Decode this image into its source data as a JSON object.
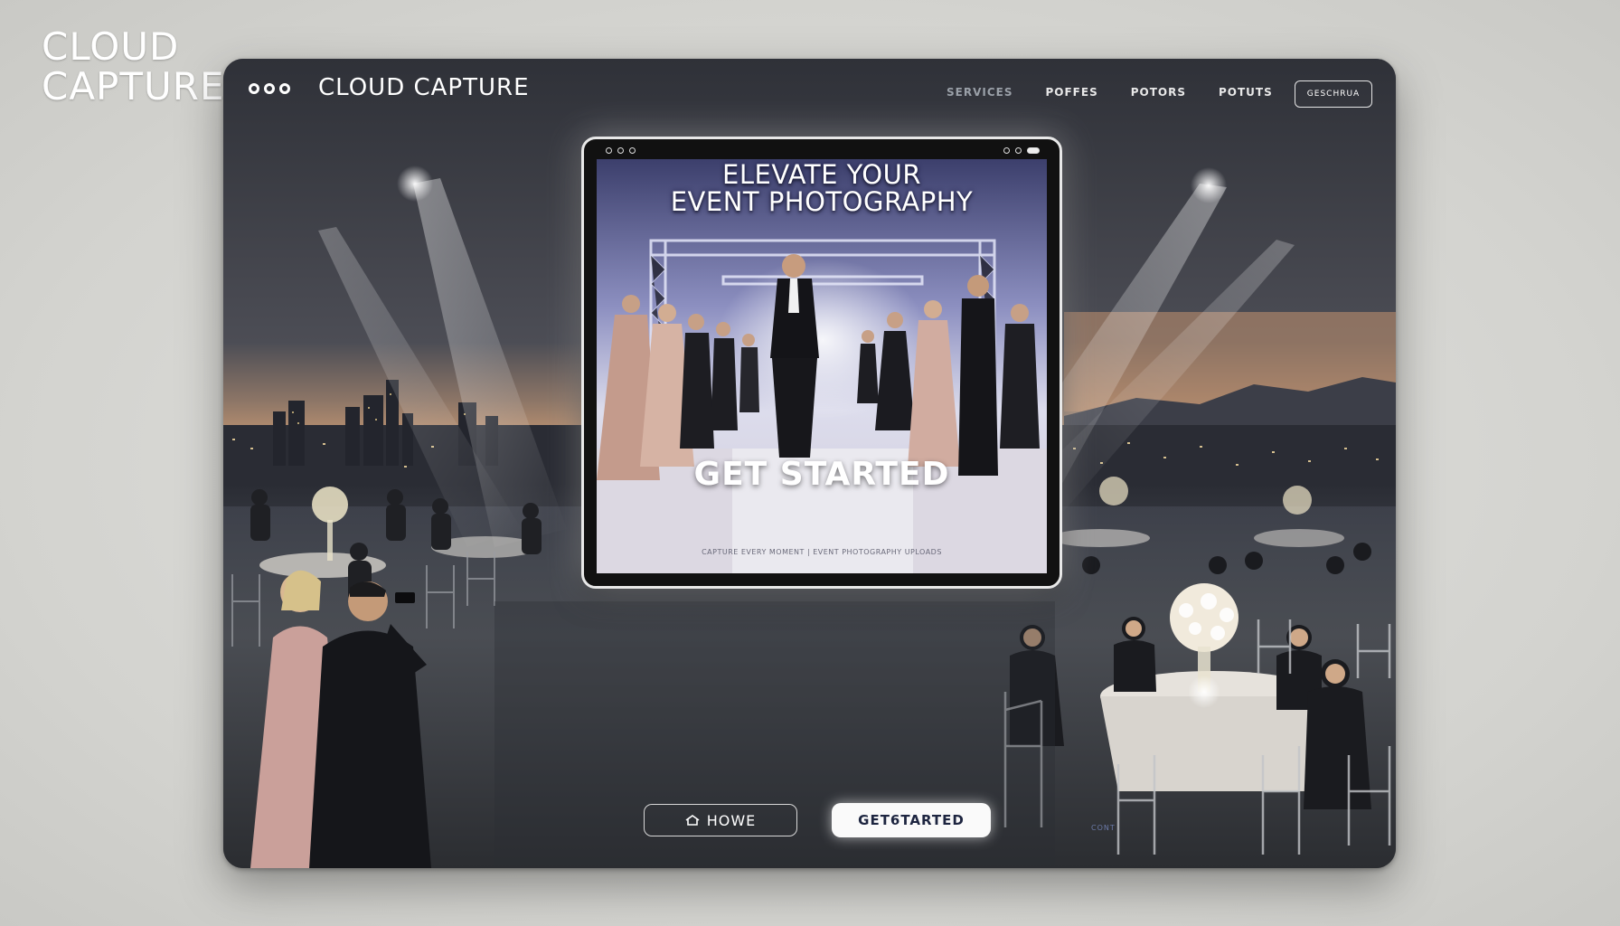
{
  "corner_logo": {
    "line1": "CLOUD",
    "line2": "CAPTURE"
  },
  "header": {
    "brand": "CLOUD CAPTURE",
    "nav": [
      {
        "label": "SERVICES",
        "dim": true
      },
      {
        "label": "POFFES",
        "dim": false
      },
      {
        "label": "POTORS",
        "dim": false
      },
      {
        "label": "POTUTS",
        "dim": false
      }
    ],
    "nav_button": "GESCHRUA"
  },
  "hero": {
    "headline_line1": "ELEVATE YOUR",
    "headline_line2": "EVENT PHOTOGRAPHY",
    "cta": "GET STARTED",
    "fineprint": "CAPTURE EVERY MOMENT | EVENT PHOTOGRAPHY UPLOADS"
  },
  "footer_buttons": {
    "home": "HOWE",
    "start": "GET6TARTED",
    "side_label": "CONT"
  },
  "colors": {
    "accent": "#ffffff",
    "frame": "#3f434a",
    "page_bg": "#d6d6d2"
  }
}
